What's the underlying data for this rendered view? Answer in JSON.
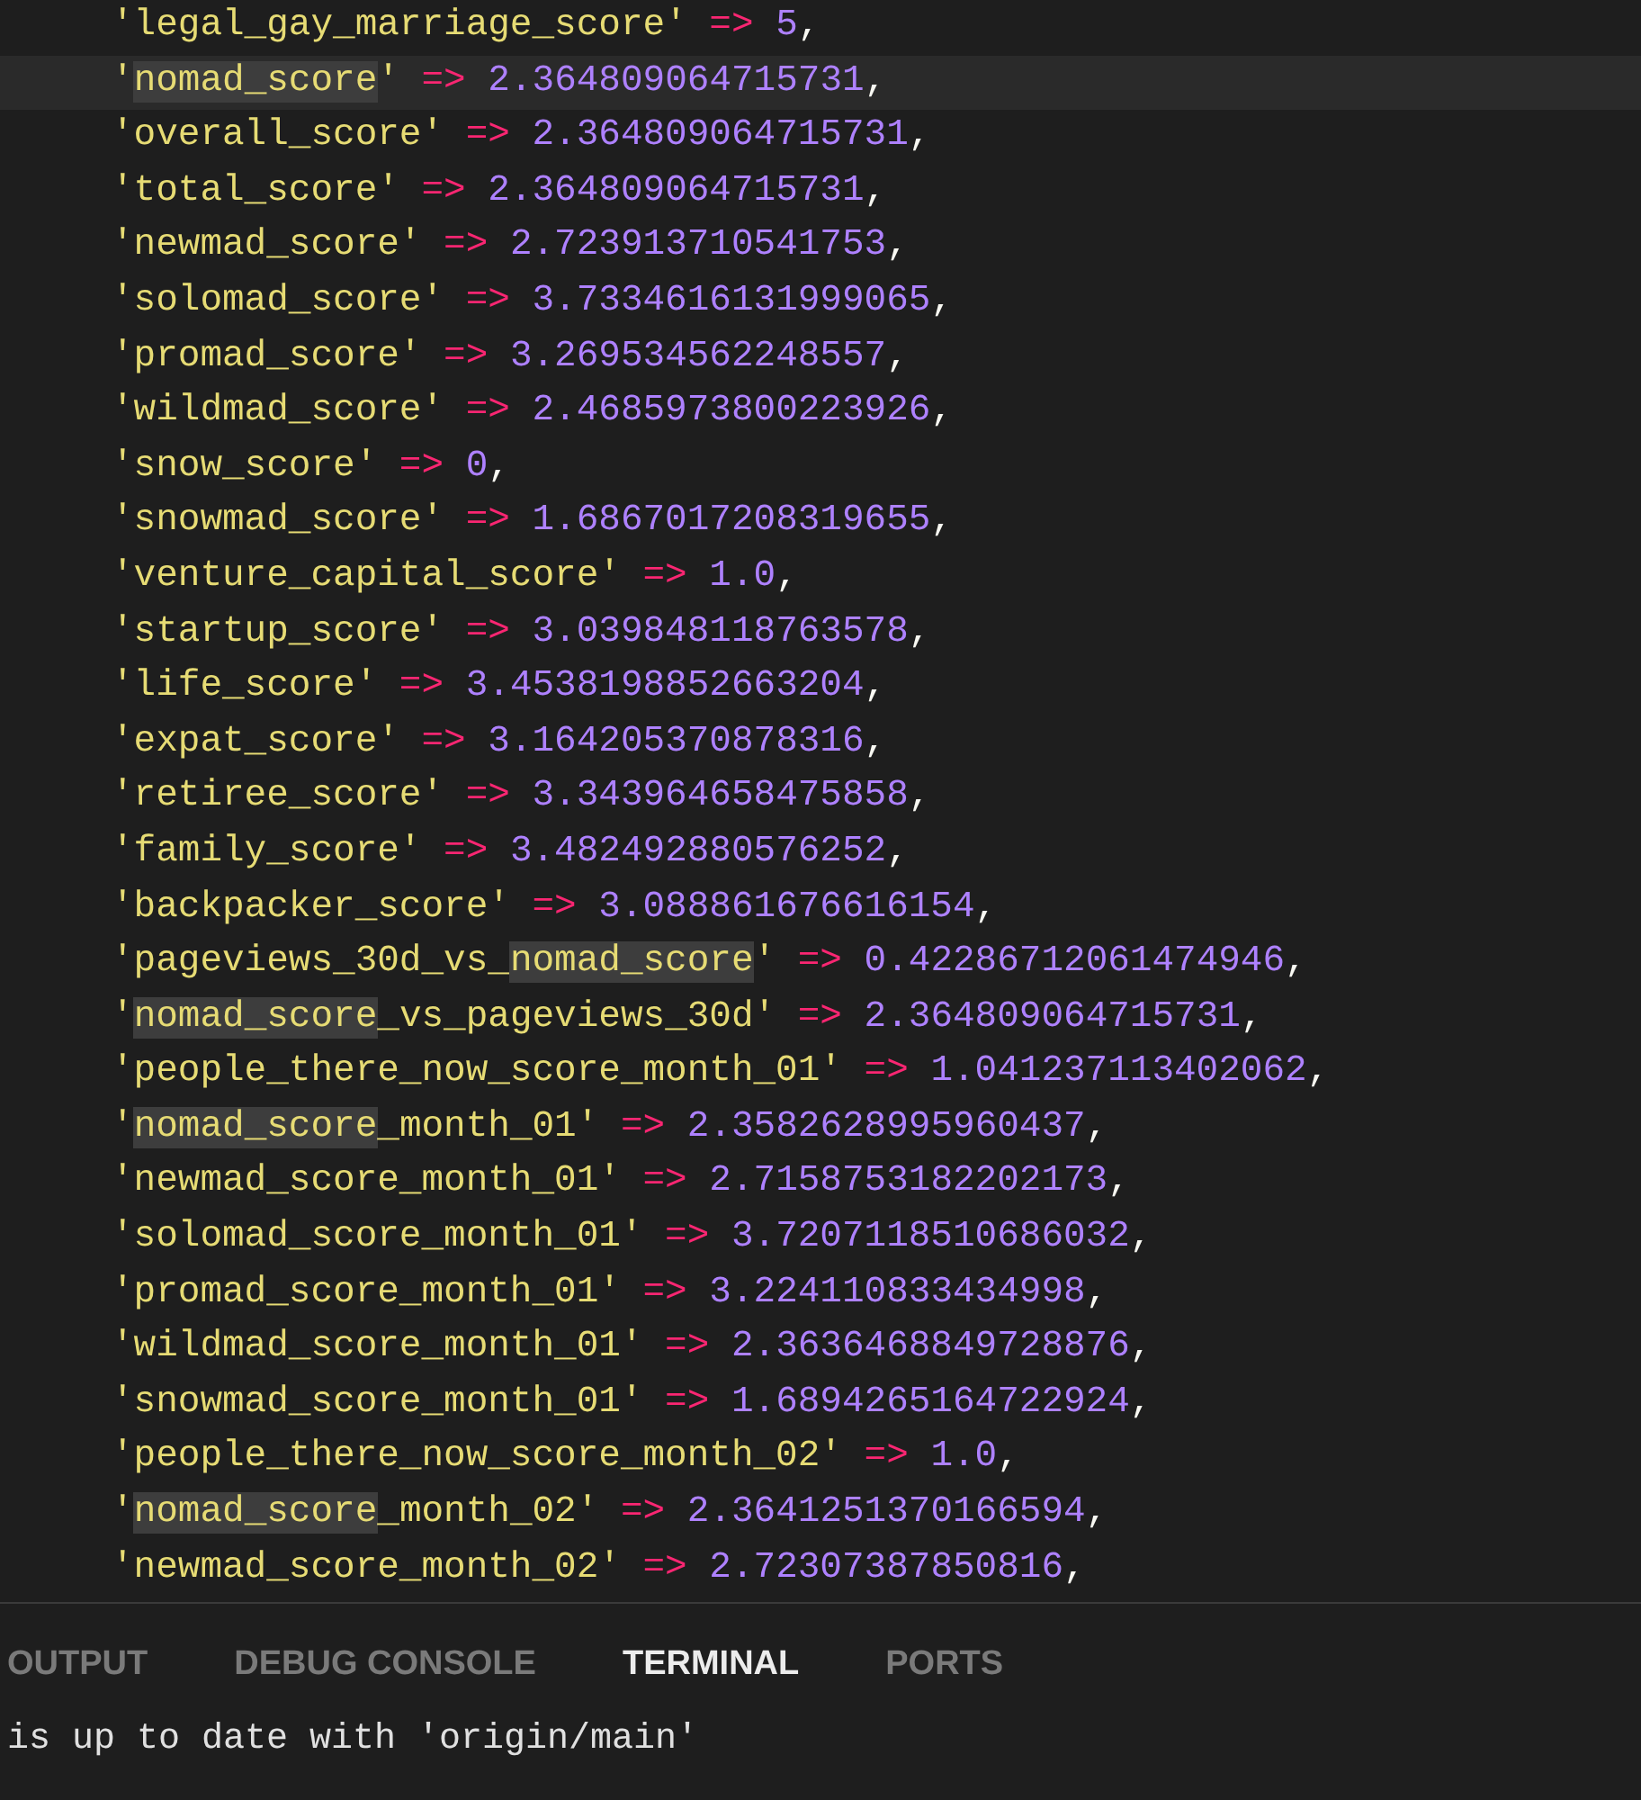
{
  "editor": {
    "lines": [
      {
        "current": false,
        "tokens": [
          {
            "kind": "string",
            "text": "'legal_gay_marriage_score'"
          },
          {
            "kind": "operator",
            "text": "=>"
          },
          {
            "kind": "number",
            "text": "5"
          },
          {
            "kind": "punct",
            "text": ","
          }
        ]
      },
      {
        "current": true,
        "tokens": [
          {
            "kind": "string",
            "text": "'"
          },
          {
            "kind": "match",
            "text": "nomad_score"
          },
          {
            "kind": "string",
            "text": "'"
          },
          {
            "kind": "operator",
            "text": "=>"
          },
          {
            "kind": "number",
            "text": "2.364809064715731"
          },
          {
            "kind": "punct",
            "text": ","
          }
        ]
      },
      {
        "current": false,
        "tokens": [
          {
            "kind": "string",
            "text": "'overall_score'"
          },
          {
            "kind": "operator",
            "text": "=>"
          },
          {
            "kind": "number",
            "text": "2.364809064715731"
          },
          {
            "kind": "punct",
            "text": ","
          }
        ]
      },
      {
        "current": false,
        "tokens": [
          {
            "kind": "string",
            "text": "'total_score'"
          },
          {
            "kind": "operator",
            "text": "=>"
          },
          {
            "kind": "number",
            "text": "2.364809064715731"
          },
          {
            "kind": "punct",
            "text": ","
          }
        ]
      },
      {
        "current": false,
        "tokens": [
          {
            "kind": "string",
            "text": "'newmad_score'"
          },
          {
            "kind": "operator",
            "text": "=>"
          },
          {
            "kind": "number",
            "text": "2.723913710541753"
          },
          {
            "kind": "punct",
            "text": ","
          }
        ]
      },
      {
        "current": false,
        "tokens": [
          {
            "kind": "string",
            "text": "'solomad_score'"
          },
          {
            "kind": "operator",
            "text": "=>"
          },
          {
            "kind": "number",
            "text": "3.7334616131999065"
          },
          {
            "kind": "punct",
            "text": ","
          }
        ]
      },
      {
        "current": false,
        "tokens": [
          {
            "kind": "string",
            "text": "'promad_score'"
          },
          {
            "kind": "operator",
            "text": "=>"
          },
          {
            "kind": "number",
            "text": "3.269534562248557"
          },
          {
            "kind": "punct",
            "text": ","
          }
        ]
      },
      {
        "current": false,
        "tokens": [
          {
            "kind": "string",
            "text": "'wildmad_score'"
          },
          {
            "kind": "operator",
            "text": "=>"
          },
          {
            "kind": "number",
            "text": "2.4685973800223926"
          },
          {
            "kind": "punct",
            "text": ","
          }
        ]
      },
      {
        "current": false,
        "tokens": [
          {
            "kind": "string",
            "text": "'snow_score'"
          },
          {
            "kind": "operator",
            "text": "=>"
          },
          {
            "kind": "number",
            "text": "0"
          },
          {
            "kind": "punct",
            "text": ","
          }
        ]
      },
      {
        "current": false,
        "tokens": [
          {
            "kind": "string",
            "text": "'snowmad_score'"
          },
          {
            "kind": "operator",
            "text": "=>"
          },
          {
            "kind": "number",
            "text": "1.6867017208319655"
          },
          {
            "kind": "punct",
            "text": ","
          }
        ]
      },
      {
        "current": false,
        "tokens": [
          {
            "kind": "string",
            "text": "'venture_capital_score'"
          },
          {
            "kind": "operator",
            "text": "=>"
          },
          {
            "kind": "number",
            "text": "1.0"
          },
          {
            "kind": "punct",
            "text": ","
          }
        ]
      },
      {
        "current": false,
        "tokens": [
          {
            "kind": "string",
            "text": "'startup_score'"
          },
          {
            "kind": "operator",
            "text": "=>"
          },
          {
            "kind": "number",
            "text": "3.039848118763578"
          },
          {
            "kind": "punct",
            "text": ","
          }
        ]
      },
      {
        "current": false,
        "tokens": [
          {
            "kind": "string",
            "text": "'life_score'"
          },
          {
            "kind": "operator",
            "text": "=>"
          },
          {
            "kind": "number",
            "text": "3.4538198852663204"
          },
          {
            "kind": "punct",
            "text": ","
          }
        ]
      },
      {
        "current": false,
        "tokens": [
          {
            "kind": "string",
            "text": "'expat_score'"
          },
          {
            "kind": "operator",
            "text": "=>"
          },
          {
            "kind": "number",
            "text": "3.164205370878316"
          },
          {
            "kind": "punct",
            "text": ","
          }
        ]
      },
      {
        "current": false,
        "tokens": [
          {
            "kind": "string",
            "text": "'retiree_score'"
          },
          {
            "kind": "operator",
            "text": "=>"
          },
          {
            "kind": "number",
            "text": "3.343964658475858"
          },
          {
            "kind": "punct",
            "text": ","
          }
        ]
      },
      {
        "current": false,
        "tokens": [
          {
            "kind": "string",
            "text": "'family_score'"
          },
          {
            "kind": "operator",
            "text": "=>"
          },
          {
            "kind": "number",
            "text": "3.482492880576252"
          },
          {
            "kind": "punct",
            "text": ","
          }
        ]
      },
      {
        "current": false,
        "tokens": [
          {
            "kind": "string",
            "text": "'backpacker_score'"
          },
          {
            "kind": "operator",
            "text": "=>"
          },
          {
            "kind": "number",
            "text": "3.088861676616154"
          },
          {
            "kind": "punct",
            "text": ","
          }
        ]
      },
      {
        "current": false,
        "tokens": [
          {
            "kind": "string",
            "text": "'pageviews_30d_vs_"
          },
          {
            "kind": "match",
            "text": "nomad_score"
          },
          {
            "kind": "string",
            "text": "'"
          },
          {
            "kind": "operator",
            "text": "=>"
          },
          {
            "kind": "number",
            "text": "0.42286712061474946"
          },
          {
            "kind": "punct",
            "text": ","
          }
        ]
      },
      {
        "current": false,
        "tokens": [
          {
            "kind": "string",
            "text": "'"
          },
          {
            "kind": "match",
            "text": "nomad_score"
          },
          {
            "kind": "string",
            "text": "_vs_pageviews_30d'"
          },
          {
            "kind": "operator",
            "text": "=>"
          },
          {
            "kind": "number",
            "text": "2.364809064715731"
          },
          {
            "kind": "punct",
            "text": ","
          }
        ]
      },
      {
        "current": false,
        "tokens": [
          {
            "kind": "string",
            "text": "'people_there_now_score_month_01'"
          },
          {
            "kind": "operator",
            "text": "=>"
          },
          {
            "kind": "number",
            "text": "1.041237113402062"
          },
          {
            "kind": "punct",
            "text": ","
          }
        ]
      },
      {
        "current": false,
        "tokens": [
          {
            "kind": "string",
            "text": "'"
          },
          {
            "kind": "match",
            "text": "nomad_score"
          },
          {
            "kind": "string",
            "text": "_month_01'"
          },
          {
            "kind": "operator",
            "text": "=>"
          },
          {
            "kind": "number",
            "text": "2.3582628995960437"
          },
          {
            "kind": "punct",
            "text": ","
          }
        ]
      },
      {
        "current": false,
        "tokens": [
          {
            "kind": "string",
            "text": "'newmad_score_month_01'"
          },
          {
            "kind": "operator",
            "text": "=>"
          },
          {
            "kind": "number",
            "text": "2.7158753182202173"
          },
          {
            "kind": "punct",
            "text": ","
          }
        ]
      },
      {
        "current": false,
        "tokens": [
          {
            "kind": "string",
            "text": "'solomad_score_month_01'"
          },
          {
            "kind": "operator",
            "text": "=>"
          },
          {
            "kind": "number",
            "text": "3.7207118510686032"
          },
          {
            "kind": "punct",
            "text": ","
          }
        ]
      },
      {
        "current": false,
        "tokens": [
          {
            "kind": "string",
            "text": "'promad_score_month_01'"
          },
          {
            "kind": "operator",
            "text": "=>"
          },
          {
            "kind": "number",
            "text": "3.224110833434998"
          },
          {
            "kind": "punct",
            "text": ","
          }
        ]
      },
      {
        "current": false,
        "tokens": [
          {
            "kind": "string",
            "text": "'wildmad_score_month_01'"
          },
          {
            "kind": "operator",
            "text": "=>"
          },
          {
            "kind": "number",
            "text": "2.3636468849728876"
          },
          {
            "kind": "punct",
            "text": ","
          }
        ]
      },
      {
        "current": false,
        "tokens": [
          {
            "kind": "string",
            "text": "'snowmad_score_month_01'"
          },
          {
            "kind": "operator",
            "text": "=>"
          },
          {
            "kind": "number",
            "text": "1.6894265164722924"
          },
          {
            "kind": "punct",
            "text": ","
          }
        ]
      },
      {
        "current": false,
        "tokens": [
          {
            "kind": "string",
            "text": "'people_there_now_score_month_02'"
          },
          {
            "kind": "operator",
            "text": "=>"
          },
          {
            "kind": "number",
            "text": "1.0"
          },
          {
            "kind": "punct",
            "text": ","
          }
        ]
      },
      {
        "current": false,
        "tokens": [
          {
            "kind": "string",
            "text": "'"
          },
          {
            "kind": "match",
            "text": "nomad_score"
          },
          {
            "kind": "string",
            "text": "_month_02'"
          },
          {
            "kind": "operator",
            "text": "=>"
          },
          {
            "kind": "number",
            "text": "2.3641251370166594"
          },
          {
            "kind": "punct",
            "text": ","
          }
        ]
      },
      {
        "current": false,
        "tokens": [
          {
            "kind": "string",
            "text": "'newmad_score_month_02'"
          },
          {
            "kind": "operator",
            "text": "=>"
          },
          {
            "kind": "number",
            "text": "2.72307387850816"
          },
          {
            "kind": "punct",
            "text": ","
          }
        ]
      }
    ]
  },
  "panel": {
    "tabs": [
      {
        "label": "OUTPUT",
        "selected": false
      },
      {
        "label": "DEBUG CONSOLE",
        "selected": false
      },
      {
        "label": "TERMINAL",
        "selected": true
      },
      {
        "label": "PORTS",
        "selected": false
      }
    ],
    "terminal_lines": [
      "is up to date with 'origin/main'"
    ]
  }
}
